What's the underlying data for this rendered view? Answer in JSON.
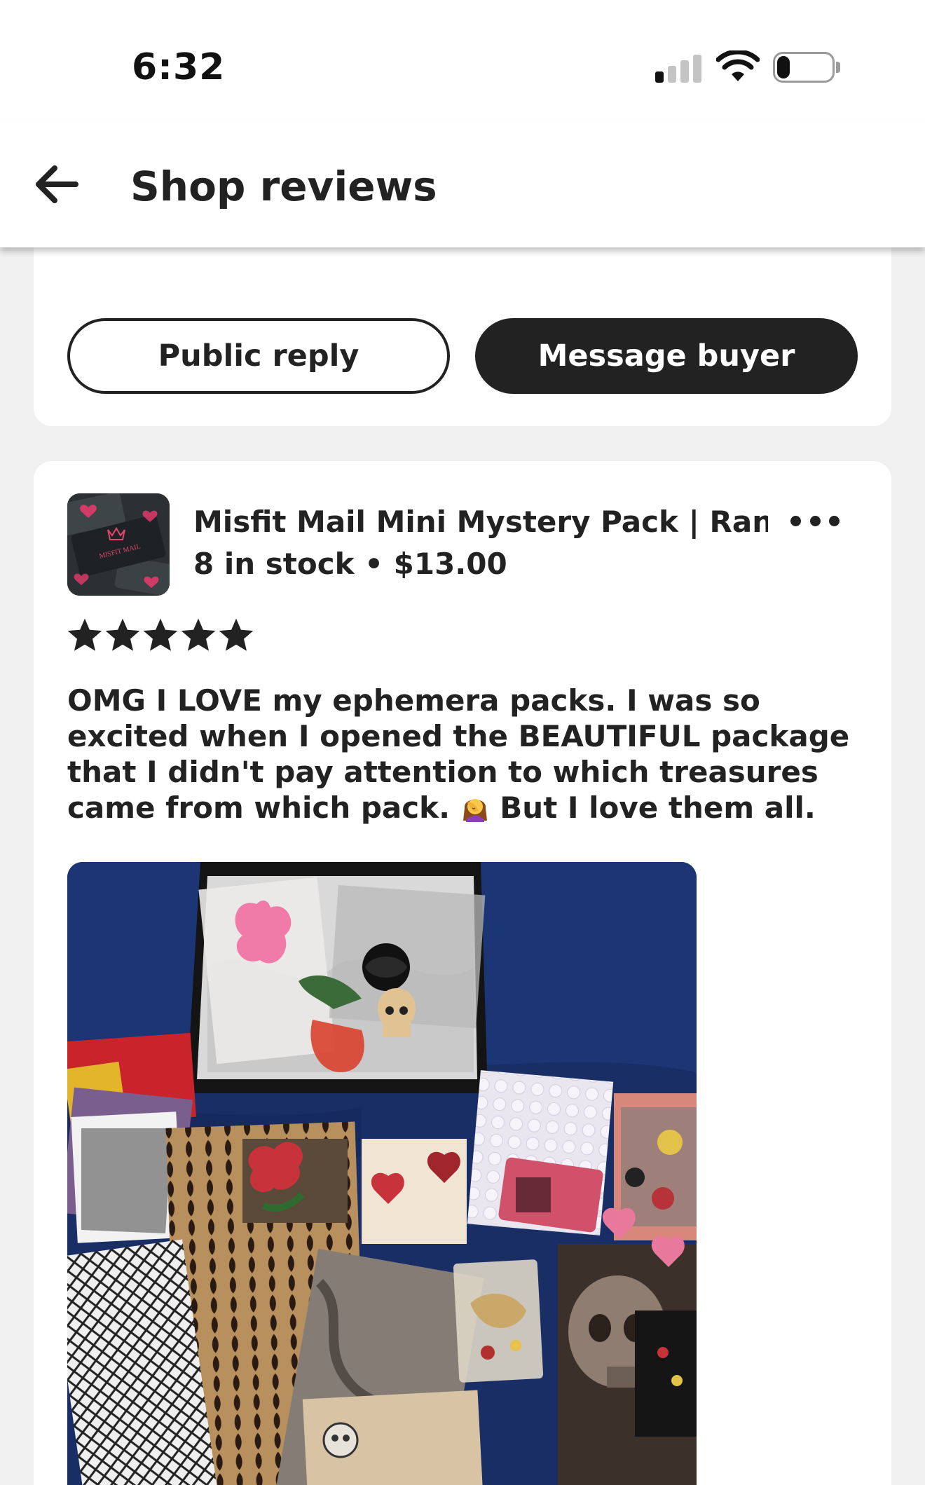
{
  "status_bar": {
    "time": "6:32",
    "battery_percent": "22",
    "battery_level": 0.22,
    "signal_bars": 1,
    "icons": [
      "cellular-signal-icon",
      "wifi-icon",
      "battery-icon"
    ]
  },
  "header": {
    "back_icon": "arrow-left-icon",
    "title": "Shop reviews"
  },
  "actions": {
    "public_reply_label": "Public reply",
    "message_buyer_label": "Message buyer"
  },
  "review": {
    "listing_title": "Misfit Mail Mini Mystery Pack | Ran...",
    "stock": "8 in stock",
    "separator": " • ",
    "price": "$13.00",
    "rating": 5,
    "rating_max": 5,
    "text_before_emoji": "OMG I LOVE my ephemera packs.  I was so excited when I opened the BEAUTIFUL package that I didn't pay attention to which treasures came from which pack. ",
    "emoji_icon": "woman-facepalming-emoji-icon",
    "text_after_emoji": " But I love them all.",
    "thumbnail_logo_text": "MISFIT MAIL"
  },
  "colors": {
    "text": "#222222",
    "background": "#f0f0f0",
    "card": "#ffffff",
    "button_dark": "#222222"
  }
}
